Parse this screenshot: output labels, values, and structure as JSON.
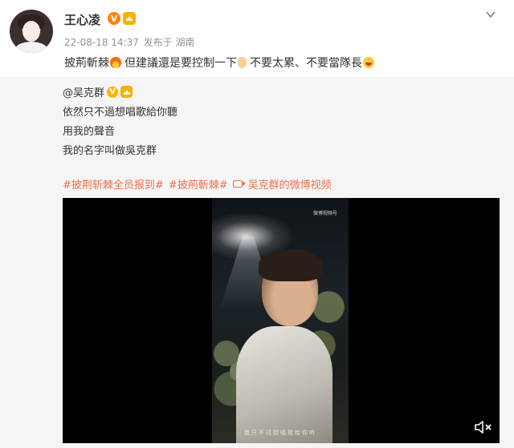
{
  "post": {
    "username": "王心凌",
    "vip_badge": "V",
    "timestamp": "22-08-18 14:37",
    "source": "发布于 湖南",
    "text_part1": "披荊斬棘",
    "text_part2": "但建議還是要控制一下",
    "text_part3": "不要太累、不要當隊長",
    "emoji_1": "fire-emoji",
    "emoji_2": "hand-emoji",
    "emoji_3": "laugh-emoji"
  },
  "retweet": {
    "author": "@吴克群",
    "vip_badge": "V",
    "lines": [
      "依然只不過想唱歌給你聽",
      "用我的聲音",
      "我的名字叫做吳克群"
    ],
    "hashtag_1": "#披荆斩棘全员报到#",
    "hashtag_2": "#披荊斬棘#",
    "video_link": "吴克群的微博视频",
    "video": {
      "watermark": "微博视频号",
      "subtitle": "我只不过想唱歌给你听"
    }
  },
  "colors": {
    "link": "#eb7350",
    "verified": "#ff8200",
    "card_bg": "#f5f5f5"
  }
}
